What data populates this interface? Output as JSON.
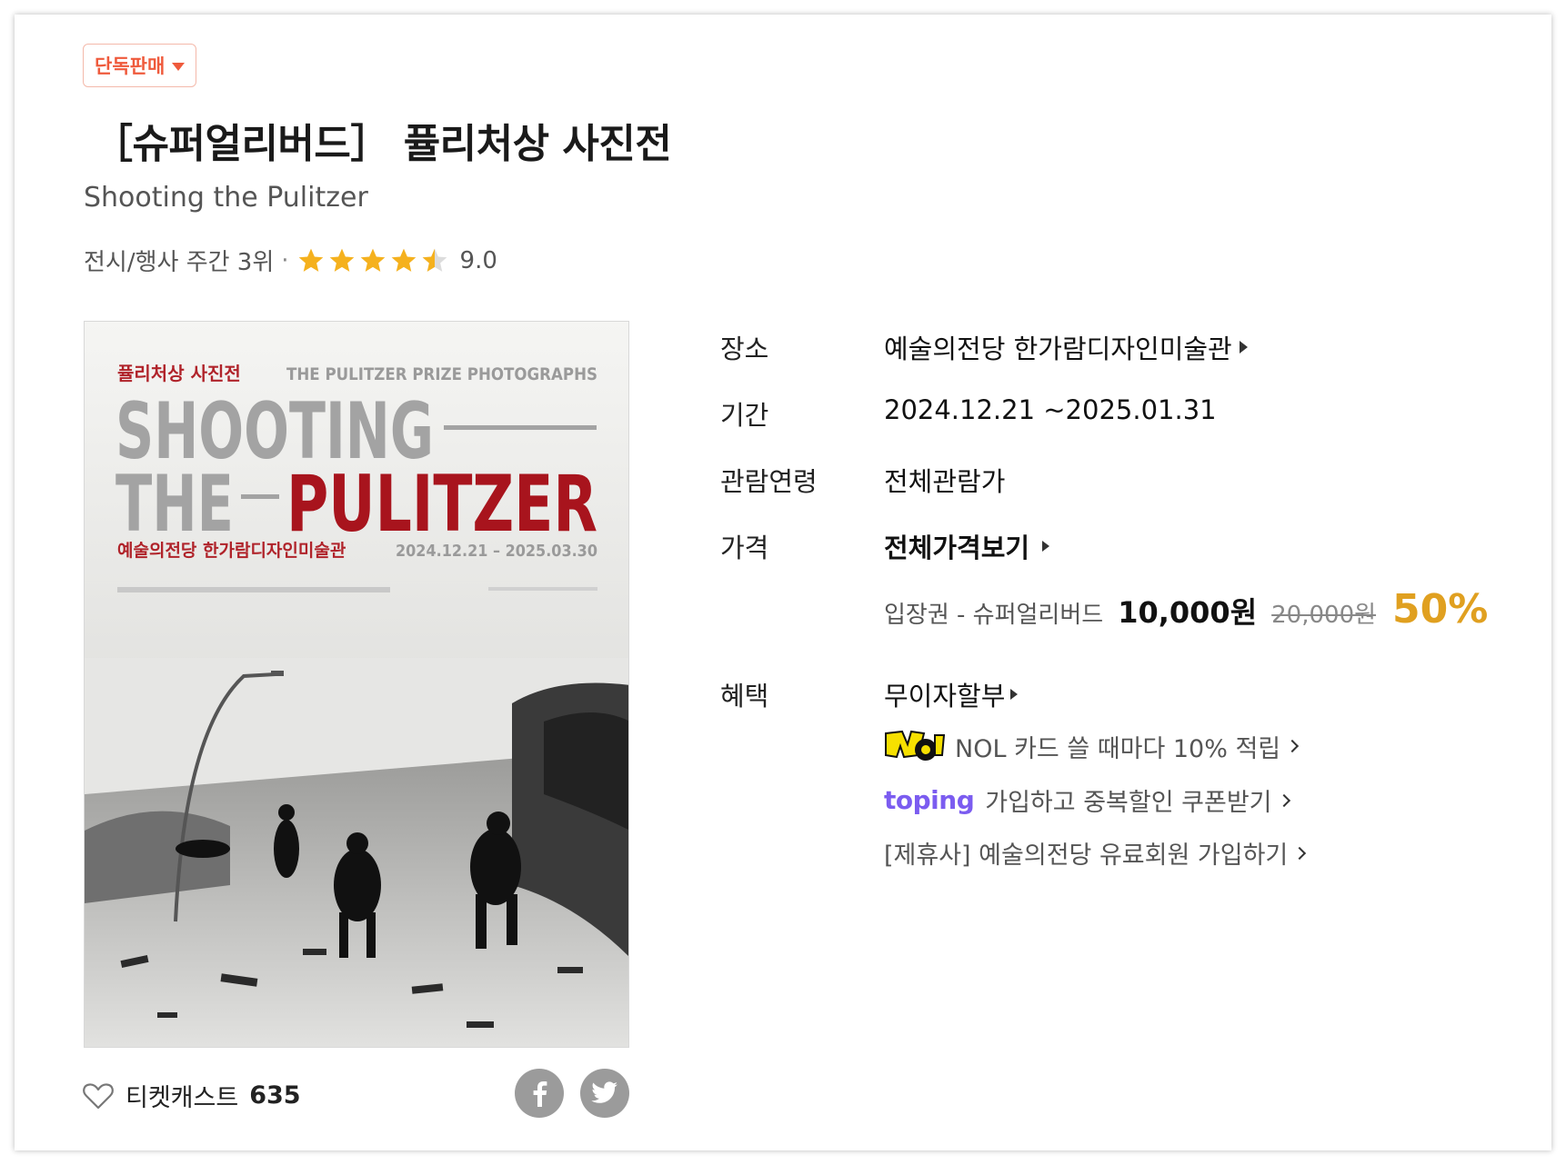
{
  "badge": {
    "label": "단독판매"
  },
  "title": "［슈퍼얼리버드］ 퓰리처상 사진전",
  "subtitle": "Shooting the Pulitzer",
  "rank": {
    "text": "전시/행사 주간 3위",
    "separator": "·",
    "rating": "9.0",
    "stars": 4.5
  },
  "poster": {
    "kr_title": "퓰리처상 사진전",
    "en_title": "THE PULITZER PRIZE PHOTOGRAPHS",
    "line1": "SHOOTING",
    "line2a": "THE",
    "line2b": "PULITZER",
    "venue": "예술의전당 한가람디자인미술관",
    "dates": "2024.12.21 – 2025.03.30"
  },
  "ticketcast": {
    "label": "티켓캐스트",
    "count": "635"
  },
  "share": {
    "facebook": "facebook-icon",
    "twitter": "twitter-icon"
  },
  "info": {
    "venue_label": "장소",
    "venue_value": "예술의전당 한가람디자인미술관",
    "period_label": "기간",
    "period_value": "2024.12.21 ~2025.01.31",
    "age_label": "관람연령",
    "age_value": "전체관람가",
    "price_label": "가격",
    "price_all": "전체가격보기",
    "ticket_name": "입장권 - 슈퍼얼리버드",
    "sale_price": "10,000원",
    "orig_price": "20,000원",
    "discount": "50%",
    "benefit_label": "혜택",
    "installment": "무이자할부",
    "nol_text": "NOL 카드 쓸 때마다 10% 적립",
    "toping_logo": "toping",
    "toping_text": "가입하고 중복할인 쿠폰받기",
    "partner_text": "[제휴사] 예술의전당 유료회원 가입하기"
  },
  "colors": {
    "accent_red": "#ef5a3c",
    "discount": "#e0a020",
    "toping": "#7b5cf0",
    "nol": "#f6e000"
  }
}
